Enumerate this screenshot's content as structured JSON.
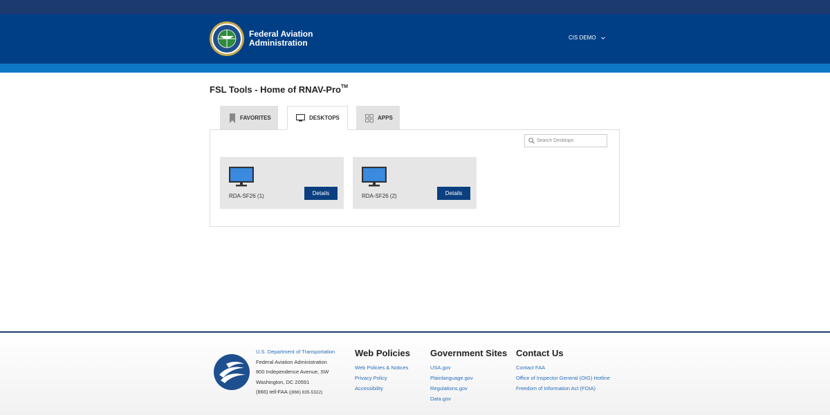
{
  "header": {
    "agency_line1": "Federal Aviation",
    "agency_line2": "Administration",
    "user_menu": "CIS DEMO"
  },
  "page": {
    "title": "FSL Tools - Home of RNAV-Pro",
    "title_tm": "TM"
  },
  "tabs": [
    {
      "label": "FAVORITES",
      "icon": "bookmark-icon",
      "active": false
    },
    {
      "label": "DESKTOPS",
      "icon": "monitor-icon",
      "active": true
    },
    {
      "label": "APPS",
      "icon": "grid-icon",
      "active": false
    }
  ],
  "search": {
    "placeholder": "Search Desktops"
  },
  "desktops": [
    {
      "label": "RDA-SF26 (1)",
      "button": "Details"
    },
    {
      "label": "RDA-SF26 (2)",
      "button": "Details"
    }
  ],
  "footer": {
    "dot": {
      "link": "U.S. Department of Transportation",
      "line1": "Federal Aviation Administration",
      "line2": "800 Independence Avenue, SW",
      "line3": "Washington, DC 20591",
      "phone_main": "(866) tell-FAA",
      "phone_alt": "((866) 835-5322)"
    },
    "web_policies": {
      "heading": "Web Policies",
      "links": [
        "Web Policies & Notices",
        "Privacy Policy",
        "Accessibility"
      ]
    },
    "gov_sites": {
      "heading": "Government Sites",
      "links": [
        "USA.gov",
        "Plainlanguage.gov",
        "Regulations.gov",
        "Data.gov"
      ]
    },
    "contact": {
      "heading": "Contact Us",
      "links": [
        "Contact FAA",
        "Office of Inspector General (OIG) Hotline",
        "Freedom of Information Act (FOIA)"
      ]
    }
  },
  "colors": {
    "header": "#003f86",
    "header_band": "#0f78c6",
    "button": "#0b3f80",
    "link": "#2a6ebb"
  }
}
